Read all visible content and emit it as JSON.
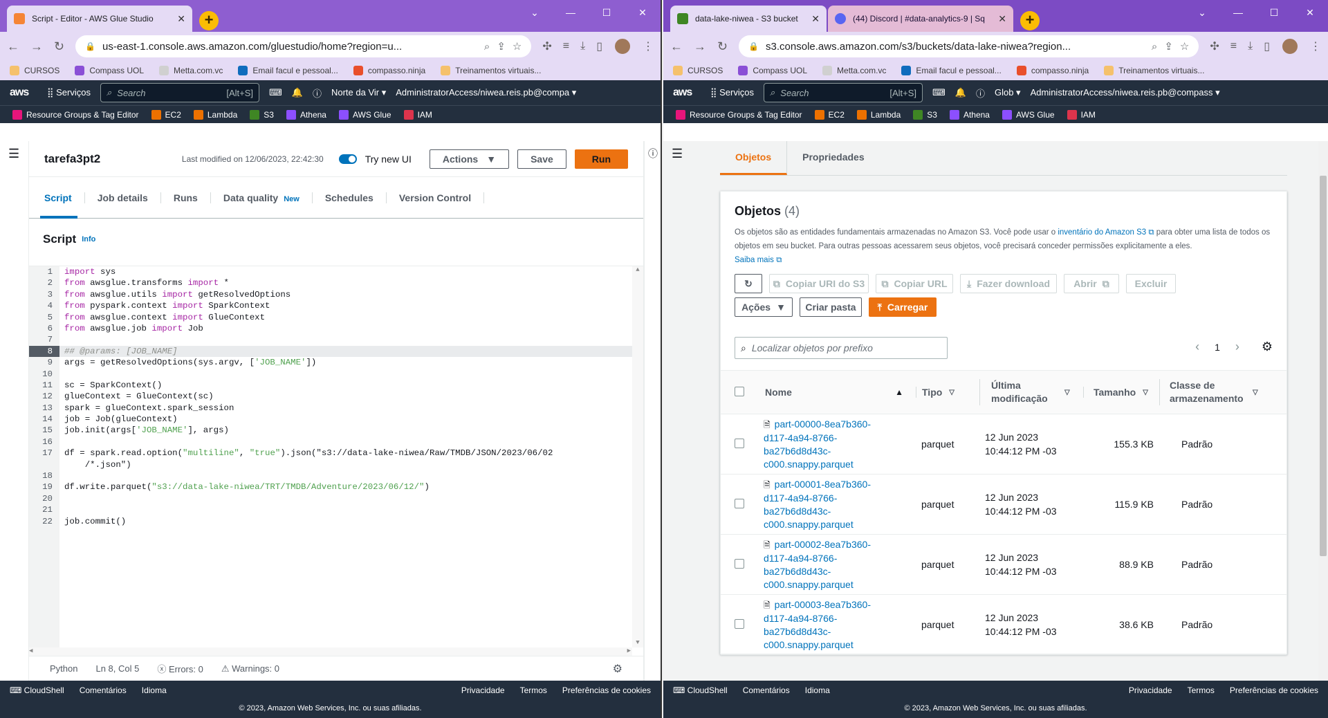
{
  "left": {
    "tab": {
      "title": "Script - Editor - AWS Glue Studio",
      "fav_color": "#f58536"
    },
    "url": "us-east-1.console.aws.amazon.com/gluestudio/home?region=u...",
    "bookmarks": [
      {
        "label": "CURSOS",
        "color": "#f5c16c"
      },
      {
        "label": "Compass UOL",
        "color": "#8a4fd6"
      },
      {
        "label": "Metta.com.vc",
        "color": "#d0d0d0"
      },
      {
        "label": "Email facul e pessoal...",
        "color": "#0f6cbd"
      },
      {
        "label": "compasso.ninja",
        "color": "#e94f2b"
      },
      {
        "label": "Treinamentos virtuais...",
        "color": "#f5c16c"
      }
    ],
    "aws": {
      "logo": "aws",
      "services": "Serviços",
      "search_placeholder": "Search",
      "search_shortcut": "[Alt+S]",
      "region": "Norte da Vir",
      "account": "AdministratorAccess/niwea.reis.pb@compa"
    },
    "favorites": [
      {
        "label": "Resource Groups & Tag Editor",
        "color": "#e7157b"
      },
      {
        "label": "EC2",
        "color": "#ed7100"
      },
      {
        "label": "Lambda",
        "color": "#ed7100"
      },
      {
        "label": "S3",
        "color": "#3f8624"
      },
      {
        "label": "Athena",
        "color": "#8c4fff"
      },
      {
        "label": "AWS Glue",
        "color": "#8c4fff"
      },
      {
        "label": "IAM",
        "color": "#dd344c"
      }
    ],
    "glue": {
      "job_name": "tarefa3pt2",
      "last_modified": "Last modified on 12/06/2023, 22:42:30",
      "try_new_ui": "Try new UI",
      "actions": "Actions",
      "save": "Save",
      "run": "Run",
      "tabs": [
        "Script",
        "Job details",
        "Runs",
        "Data quality",
        "Schedules",
        "Version Control"
      ],
      "tab_new_badge": "New",
      "script_title": "Script",
      "script_info": "Info",
      "line_numbers": [
        "1",
        "2",
        "3",
        "4",
        "5",
        "6",
        "7",
        "8",
        "9",
        "10",
        "11",
        "12",
        "13",
        "14",
        "15",
        "16",
        "17",
        "",
        "18",
        "19",
        "20",
        "21",
        "22"
      ],
      "code": [
        "import sys",
        "from awsglue.transforms import *",
        "from awsglue.utils import getResolvedOptions",
        "from pyspark.context import SparkContext",
        "from awsglue.context import GlueContext",
        "from awsglue.job import Job",
        "",
        "## @params: [JOB_NAME]",
        "args = getResolvedOptions(sys.argv, ['JOB_NAME'])",
        "",
        "sc = SparkContext()",
        "glueContext = GlueContext(sc)",
        "spark = glueContext.spark_session",
        "job = Job(glueContext)",
        "job.init(args['JOB_NAME'], args)",
        "",
        "df = spark.read.option(\"multiline\", \"true\").json(\"s3://data-lake-niwea/Raw/TMDB/JSON/2023/06/02",
        "    /*.json\")",
        "",
        "df.write.parquet(\"s3://data-lake-niwea/TRT/TMDB/Adventure/2023/06/12/\")",
        "",
        "",
        "job.commit()"
      ],
      "active_line": 7,
      "status": {
        "language": "Python",
        "cursor": "Ln 8, Col 5",
        "errors": "Errors: 0",
        "warnings": "Warnings: 0"
      }
    },
    "footer": {
      "cloudshell": "CloudShell",
      "comments": "Comentários",
      "language": "Idioma",
      "privacy": "Privacidade",
      "terms": "Termos",
      "cookies": "Preferências de cookies",
      "copyright": "© 2023, Amazon Web Services, Inc. ou suas afiliadas."
    }
  },
  "right": {
    "tab1": {
      "title": "data-lake-niwea - S3 bucket",
      "fav_color": "#3f8624"
    },
    "tab2": {
      "title": "(44) Discord | #data-analytics-9 | Sq",
      "fav_color": "#5865f2",
      "badge": "44"
    },
    "url": "s3.console.aws.amazon.com/s3/buckets/data-lake-niwea?region...",
    "aws": {
      "region": "Glob",
      "account": "AdministratorAccess/niwea.reis.pb@compass"
    },
    "s3": {
      "tabs": [
        "Objetos",
        "Propriedades"
      ],
      "title": "Objetos",
      "count": "(4)",
      "desc_1": "Os objetos são as entidades fundamentais armazenadas no Amazon S3. Você pode usar o ",
      "desc_link": "inventário do Amazon S3",
      "desc_2": " para obter uma lista de todos os objetos em seu bucket. Para outras pessoas acessarem seus objetos, você precisará conceder permissões explicitamente a eles.",
      "learn_more": "Saiba mais",
      "buttons": {
        "copy_uri": "Copiar URI do S3",
        "copy_url": "Copiar URL",
        "download": "Fazer download",
        "open": "Abrir",
        "delete": "Excluir",
        "actions": "Ações",
        "create_folder": "Criar pasta",
        "upload": "Carregar"
      },
      "filter_placeholder": "Localizar objetos por prefixo",
      "page": "1",
      "columns": {
        "name": "Nome",
        "type": "Tipo",
        "modified": "Última modificação",
        "size": "Tamanho",
        "storage": "Classe de armazenamento"
      },
      "rows": [
        {
          "name": [
            "part-00000-8ea7b360-",
            "d117-4a94-8766-",
            "ba27b6d8d43c-",
            "c000.snappy.parquet"
          ],
          "type": "parquet",
          "date": "12 Jun 2023",
          "time": "10:44:12 PM -03",
          "size": "155.3 KB",
          "storage": "Padrão"
        },
        {
          "name": [
            "part-00001-8ea7b360-",
            "d117-4a94-8766-",
            "ba27b6d8d43c-",
            "c000.snappy.parquet"
          ],
          "type": "parquet",
          "date": "12 Jun 2023",
          "time": "10:44:12 PM -03",
          "size": "115.9 KB",
          "storage": "Padrão"
        },
        {
          "name": [
            "part-00002-8ea7b360-",
            "d117-4a94-8766-",
            "ba27b6d8d43c-",
            "c000.snappy.parquet"
          ],
          "type": "parquet",
          "date": "12 Jun 2023",
          "time": "10:44:12 PM -03",
          "size": "88.9 KB",
          "storage": "Padrão"
        },
        {
          "name": [
            "part-00003-8ea7b360-",
            "d117-4a94-8766-",
            "ba27b6d8d43c-",
            "c000.snappy.parquet"
          ],
          "type": "parquet",
          "date": "12 Jun 2023",
          "time": "10:44:12 PM -03",
          "size": "38.6 KB",
          "storage": "Padrão"
        }
      ]
    }
  }
}
